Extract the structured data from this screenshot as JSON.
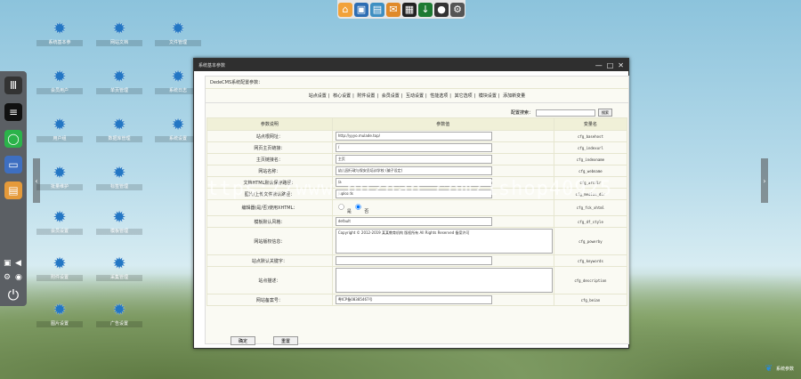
{
  "top_taskbar": {
    "icons": [
      "home-icon",
      "app-icon",
      "folder-icon",
      "mail-icon",
      "film-icon",
      "download-icon",
      "earth-icon",
      "settings-icon"
    ]
  },
  "desktop_icons": [
    {
      "label": "系统基本参"
    },
    {
      "label": "网站文档"
    },
    {
      "label": "文件管理"
    },
    {
      "label": "会员用户"
    },
    {
      "label": "单页管理"
    },
    {
      "label": "系统日志"
    },
    {
      "label": "用户组"
    },
    {
      "label": "数据库管理"
    },
    {
      "label": "系统设置"
    },
    {
      "label": "批量维护"
    },
    {
      "label": "标签管理"
    },
    {
      "label": "会员设置"
    },
    {
      "label": "模板管理"
    },
    {
      "label": "附件设置"
    },
    {
      "label": "采集管理"
    },
    {
      "label": "图片设置"
    },
    {
      "label": "广告设置"
    }
  ],
  "window": {
    "title": "系统基本参数",
    "subtitle": "DedeCMS系统配置参数：",
    "tabs": [
      "站点设置",
      "核心设置",
      "附件设置",
      "会员设置",
      "互动设置",
      "性能选项",
      "其它选项",
      "模块设置",
      "添加新变量"
    ],
    "search_label": "配置搜索：",
    "search_button": "搜索",
    "columns": [
      "参数说明",
      "参数值",
      "变量名"
    ],
    "rows": [
      {
        "name": "站点根网址：",
        "value": "http://yyyo.mulade.top/",
        "var": "cfg_basehost"
      },
      {
        "name": "网页主页链接：",
        "value": "/",
        "var": "cfg_indexurl"
      },
      {
        "name": "主页链接名：",
        "value": "主页",
        "var": "cfg_indexname"
      },
      {
        "name": "网站名称：",
        "value": "幼儿园行政与保安员培训学校 (骗子设定)",
        "var": "cfg_webname"
      },
      {
        "name": "文档HTML默认保存路径：",
        "value": "/a",
        "var": "cfg_arcdir"
      },
      {
        "name": "图片/上传文件默认路径：",
        "value": "/uploads",
        "var": "cfg_medias_dir"
      },
      {
        "name": "编辑器(是/否)使用XHTML：",
        "value": "",
        "var": "cfg_fck_xhtml",
        "radio": [
          "是",
          "否"
        ],
        "selected": 1
      },
      {
        "name": "模板默认风格：",
        "value": "default",
        "var": "cfg_df_style"
      },
      {
        "name": "网站版权信息：",
        "value": "Copyright © 2012-2019 某某教育机构 版权所有 All Rights Reserved 备案许可",
        "var": "cfg_powerby",
        "textarea": true
      },
      {
        "name": "站点默认关键字：",
        "value": "",
        "var": "cfg_keywords"
      },
      {
        "name": "站点描述：",
        "value": "",
        "var": "cfg_description",
        "textarea": true
      },
      {
        "name": "网站备案号：",
        "value": "粤ICP备08385467号",
        "var": "cfg_beian"
      }
    ],
    "buttons": [
      "确定",
      "重置"
    ]
  },
  "watermark": "https://www.huzhan.com/ishop40925",
  "bottom_right_label": "系统参数"
}
